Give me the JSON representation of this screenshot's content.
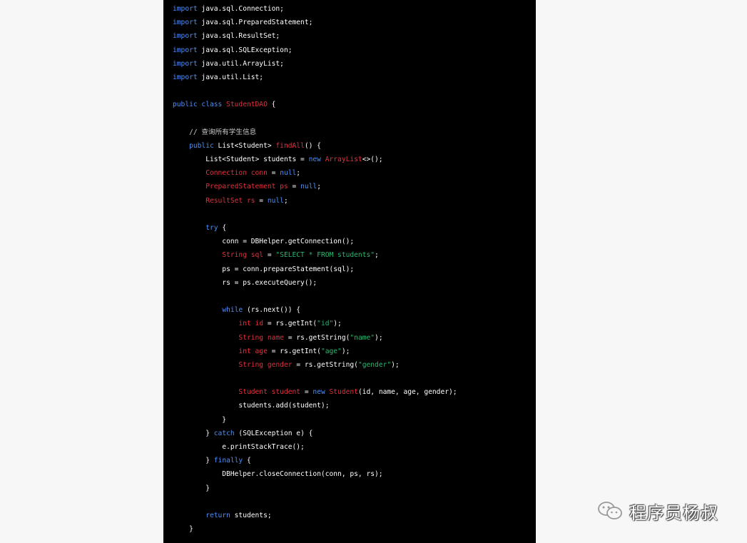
{
  "code": {
    "lines": [
      [
        {
          "t": "import",
          "c": "kw"
        },
        {
          "t": " java.sql.Connection;",
          "c": "plain"
        }
      ],
      [
        {
          "t": "import",
          "c": "kw"
        },
        {
          "t": " java.sql.PreparedStatement;",
          "c": "plain"
        }
      ],
      [
        {
          "t": "import",
          "c": "kw"
        },
        {
          "t": " java.sql.ResultSet;",
          "c": "plain"
        }
      ],
      [
        {
          "t": "import",
          "c": "kw"
        },
        {
          "t": " java.sql.SQLException;",
          "c": "plain"
        }
      ],
      [
        {
          "t": "import",
          "c": "kw"
        },
        {
          "t": " java.util.ArrayList;",
          "c": "plain"
        }
      ],
      [
        {
          "t": "import",
          "c": "kw"
        },
        {
          "t": " java.util.List;",
          "c": "plain"
        }
      ],
      [],
      [
        {
          "t": "public class ",
          "c": "kw"
        },
        {
          "t": "StudentDAO",
          "c": "type"
        },
        {
          "t": " {",
          "c": "plain"
        }
      ],
      [],
      [
        {
          "t": "    // 查询所有学生信息",
          "c": "comment"
        }
      ],
      [
        {
          "t": "    ",
          "c": "plain"
        },
        {
          "t": "public",
          "c": "kw"
        },
        {
          "t": " List<Student> ",
          "c": "plain"
        },
        {
          "t": "findAll",
          "c": "type"
        },
        {
          "t": "() {",
          "c": "plain"
        }
      ],
      [
        {
          "t": "        List<Student> students = ",
          "c": "plain"
        },
        {
          "t": "new",
          "c": "kw"
        },
        {
          "t": " ",
          "c": "plain"
        },
        {
          "t": "ArrayList",
          "c": "type"
        },
        {
          "t": "<>();",
          "c": "plain"
        }
      ],
      [
        {
          "t": "        ",
          "c": "plain"
        },
        {
          "t": "Connection conn",
          "c": "type"
        },
        {
          "t": " = ",
          "c": "plain"
        },
        {
          "t": "null",
          "c": "kw"
        },
        {
          "t": ";",
          "c": "plain"
        }
      ],
      [
        {
          "t": "        ",
          "c": "plain"
        },
        {
          "t": "PreparedStatement ps",
          "c": "type"
        },
        {
          "t": " = ",
          "c": "plain"
        },
        {
          "t": "null",
          "c": "kw"
        },
        {
          "t": ";",
          "c": "plain"
        }
      ],
      [
        {
          "t": "        ",
          "c": "plain"
        },
        {
          "t": "ResultSet rs",
          "c": "type"
        },
        {
          "t": " = ",
          "c": "plain"
        },
        {
          "t": "null",
          "c": "kw"
        },
        {
          "t": ";",
          "c": "plain"
        }
      ],
      [],
      [
        {
          "t": "        ",
          "c": "plain"
        },
        {
          "t": "try",
          "c": "kw"
        },
        {
          "t": " {",
          "c": "plain"
        }
      ],
      [
        {
          "t": "            conn = DBHelper.getConnection();",
          "c": "plain"
        }
      ],
      [
        {
          "t": "            ",
          "c": "plain"
        },
        {
          "t": "String sql",
          "c": "type"
        },
        {
          "t": " = ",
          "c": "plain"
        },
        {
          "t": "\"SELECT * FROM students\"",
          "c": "str"
        },
        {
          "t": ";",
          "c": "plain"
        }
      ],
      [
        {
          "t": "            ps = conn.prepareStatement(sql);",
          "c": "plain"
        }
      ],
      [
        {
          "t": "            rs = ps.executeQuery();",
          "c": "plain"
        }
      ],
      [],
      [
        {
          "t": "            ",
          "c": "plain"
        },
        {
          "t": "while",
          "c": "kw"
        },
        {
          "t": " (rs.next()) {",
          "c": "plain"
        }
      ],
      [
        {
          "t": "                ",
          "c": "plain"
        },
        {
          "t": "int id",
          "c": "type"
        },
        {
          "t": " = rs.getInt(",
          "c": "plain"
        },
        {
          "t": "\"id\"",
          "c": "str"
        },
        {
          "t": ");",
          "c": "plain"
        }
      ],
      [
        {
          "t": "                ",
          "c": "plain"
        },
        {
          "t": "String name",
          "c": "type"
        },
        {
          "t": " = rs.getString(",
          "c": "plain"
        },
        {
          "t": "\"name\"",
          "c": "str"
        },
        {
          "t": ");",
          "c": "plain"
        }
      ],
      [
        {
          "t": "                ",
          "c": "plain"
        },
        {
          "t": "int age",
          "c": "type"
        },
        {
          "t": " = rs.getInt(",
          "c": "plain"
        },
        {
          "t": "\"age\"",
          "c": "str"
        },
        {
          "t": ");",
          "c": "plain"
        }
      ],
      [
        {
          "t": "                ",
          "c": "plain"
        },
        {
          "t": "String gender",
          "c": "type"
        },
        {
          "t": " = rs.getString(",
          "c": "plain"
        },
        {
          "t": "\"gender\"",
          "c": "str"
        },
        {
          "t": ");",
          "c": "plain"
        }
      ],
      [],
      [
        {
          "t": "                ",
          "c": "plain"
        },
        {
          "t": "Student student",
          "c": "type"
        },
        {
          "t": " = ",
          "c": "plain"
        },
        {
          "t": "new",
          "c": "kw"
        },
        {
          "t": " ",
          "c": "plain"
        },
        {
          "t": "Student",
          "c": "type"
        },
        {
          "t": "(id, name, age, gender);",
          "c": "plain"
        }
      ],
      [
        {
          "t": "                students.add(student);",
          "c": "plain"
        }
      ],
      [
        {
          "t": "            }",
          "c": "plain"
        }
      ],
      [
        {
          "t": "        } ",
          "c": "plain"
        },
        {
          "t": "catch",
          "c": "kw"
        },
        {
          "t": " (SQLException e) {",
          "c": "plain"
        }
      ],
      [
        {
          "t": "            e.printStackTrace();",
          "c": "plain"
        }
      ],
      [
        {
          "t": "        } ",
          "c": "plain"
        },
        {
          "t": "finally",
          "c": "kw"
        },
        {
          "t": " {",
          "c": "plain"
        }
      ],
      [
        {
          "t": "            DBHelper.closeConnection(conn, ps, rs);",
          "c": "plain"
        }
      ],
      [
        {
          "t": "        }",
          "c": "plain"
        }
      ],
      [],
      [
        {
          "t": "        ",
          "c": "plain"
        },
        {
          "t": "return",
          "c": "kw"
        },
        {
          "t": " students;",
          "c": "plain"
        }
      ],
      [
        {
          "t": "    }",
          "c": "plain"
        }
      ]
    ]
  },
  "watermark": {
    "text": "程序员杨叔",
    "icon": "wechat-official-account-icon"
  }
}
